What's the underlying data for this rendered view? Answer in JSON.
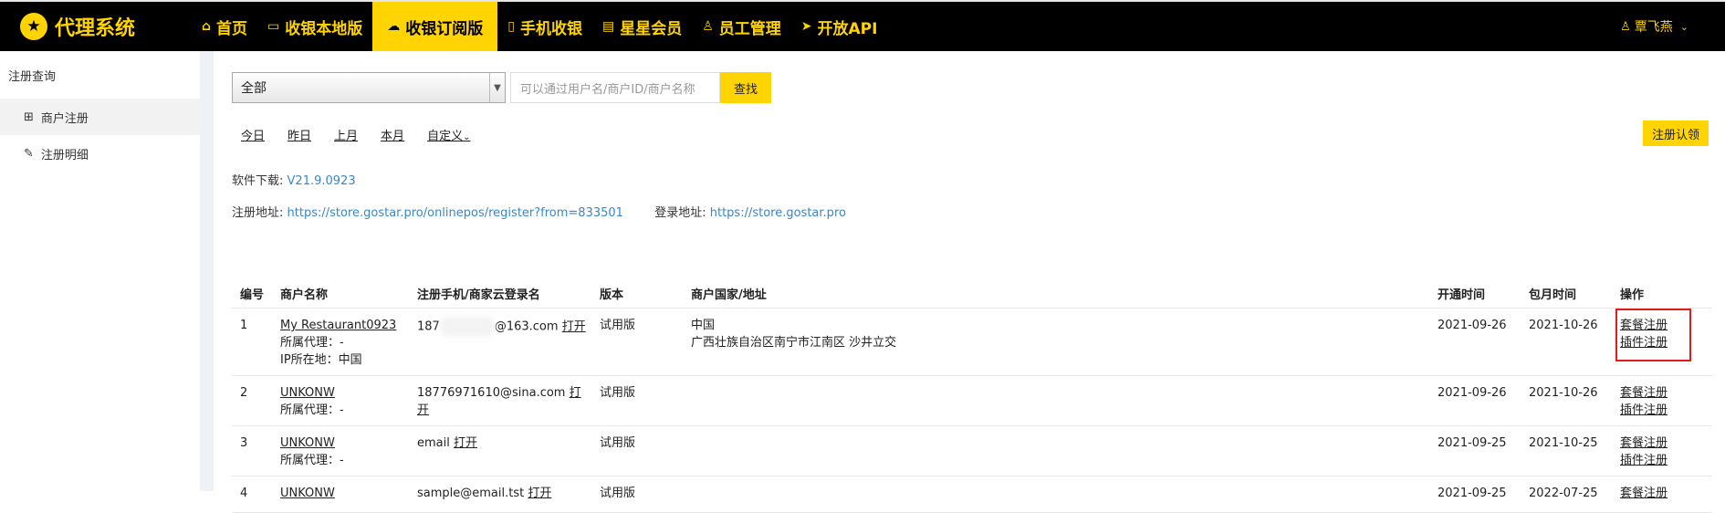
{
  "brand": {
    "title": "代理系统",
    "logo_icon": "star-icon"
  },
  "nav": {
    "items": [
      {
        "label": "首页",
        "icon": "home-icon"
      },
      {
        "label": "收银本地版",
        "icon": "monitor-icon"
      },
      {
        "label": "收银订阅版",
        "icon": "cloud-icon",
        "active": true
      },
      {
        "label": "手机收银",
        "icon": "phone-icon"
      },
      {
        "label": "星星会员",
        "icon": "book-icon"
      },
      {
        "label": "员工管理",
        "icon": "user-icon"
      },
      {
        "label": "开放API",
        "icon": "send-icon"
      }
    ],
    "user": "覃飞燕"
  },
  "sidebar": {
    "section": "注册查询",
    "items": [
      {
        "label": "商户注册",
        "icon": "grid-icon"
      },
      {
        "label": "注册明细",
        "icon": "edit-icon"
      }
    ]
  },
  "filter": {
    "select_value": "全部",
    "search_placeholder": "可以通过用户名/商户ID/商户名称",
    "search_button": "查找"
  },
  "dates": [
    "今日",
    "昨日",
    "上月",
    "本月",
    "自定义"
  ],
  "claim_button": "注册认领",
  "download": {
    "label": "软件下载:",
    "version": "V21.9.0923"
  },
  "register": {
    "label": "注册地址:",
    "url": "https://store.gostar.pro/onlinepos/register?from=833501",
    "login_label": "登录地址:",
    "login_url": "https://store.gostar.pro"
  },
  "table": {
    "headers": [
      "编号",
      "商户名称",
      "注册手机/商家云登录名",
      "版本",
      "商户国家/地址",
      "开通时间",
      "包月时间",
      "操作"
    ],
    "rows": [
      {
        "no": "1",
        "name": "My Restaurant0923",
        "agent": "所属代理：-",
        "ip": "IP所在地：中国",
        "phone_prefix": "187",
        "phone_suffix": "@163.com",
        "open": "打开",
        "version": "试用版",
        "country": "中国",
        "address": "广西壮族自治区南宁市江南区 沙井立交",
        "start": "2021-09-26",
        "month": "2021-10-26",
        "op1": "套餐注册",
        "op2": "插件注册"
      },
      {
        "no": "2",
        "name": "UNKONW",
        "agent": "所属代理：-",
        "phone": "18776971610@sina.com",
        "open": "打开",
        "version": "试用版",
        "start": "2021-09-26",
        "month": "2021-10-26",
        "op1": "套餐注册",
        "op2": "插件注册"
      },
      {
        "no": "3",
        "name": "UNKONW",
        "agent": "所属代理：-",
        "phone": "email",
        "open": "打开",
        "version": "试用版",
        "start": "2021-09-25",
        "month": "2021-10-25",
        "op1": "套餐注册",
        "op2": "插件注册"
      },
      {
        "no": "4",
        "name": "UNKONW",
        "phone": "sample@email.tst",
        "open": "打开",
        "version": "试用版",
        "start": "2021-09-25",
        "month": "2022-07-25",
        "op1": "套餐注册"
      }
    ]
  },
  "colors": {
    "accent": "#ffd400",
    "topbar": "#000000",
    "link": "#3a86c8",
    "highlight": "#e21b1b"
  }
}
